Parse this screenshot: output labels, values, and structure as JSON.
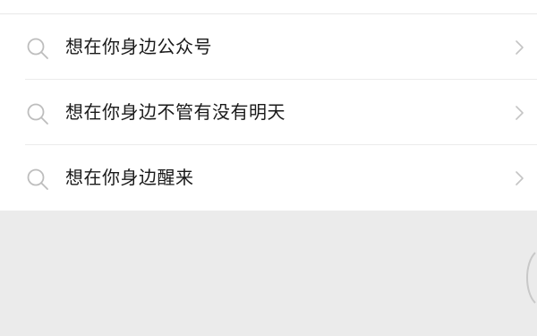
{
  "suggestions": [
    {
      "text": "想在你身边公众号",
      "icon": "search-icon",
      "arrow": "chevron-right-icon"
    },
    {
      "text": "想在你身边不管有没有明天",
      "icon": "search-icon",
      "arrow": "chevron-right-icon"
    },
    {
      "text": "想在你身边醒来",
      "icon": "search-icon",
      "arrow": "chevron-right-icon"
    }
  ],
  "colors": {
    "list_background": "#ffffff",
    "page_background": "#ebebeb",
    "text": "#1a1a1a",
    "icon": "#bdbdbd"
  }
}
